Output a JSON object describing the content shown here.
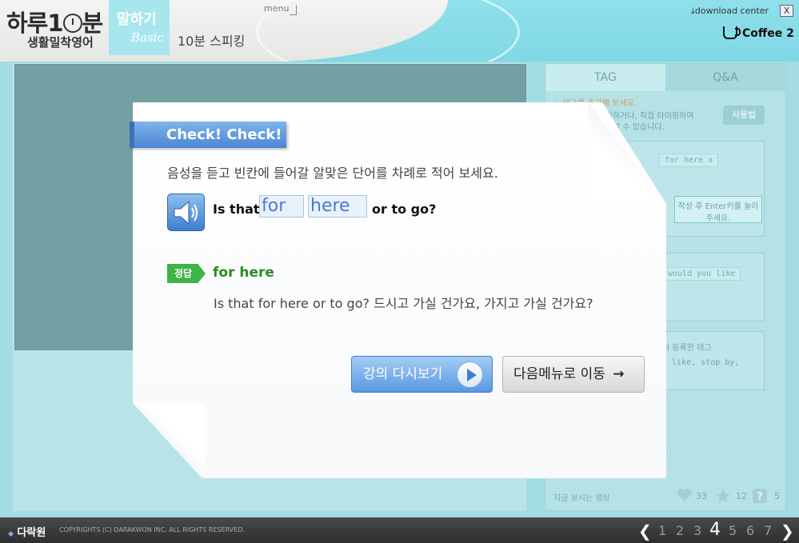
{
  "header": {
    "logo_main_a": "하루1",
    "logo_main_b": "분",
    "logo_sub": "생활밀착영어",
    "tab_title": "말하기",
    "tab_subtitle": "Basic",
    "subtitle": "10분 스피킹",
    "menu": "menu",
    "download": "download center",
    "close": "X",
    "coffee": "Coffee 2"
  },
  "right_panel": {
    "tabs": [
      "TAG",
      "Q&A"
    ],
    "hint1": "+ 태그를 추가해 보세요.",
    "hint2": "그를 클릭하거나, 직접 타이핑하여",
    "hint3": "까지 추가할 수 있습니다.",
    "use_button": "사용법",
    "tag_example": "for here",
    "tag_x": "x",
    "bubble": "작성 후 Enter키를 눌러 주세요.",
    "tag2": "would you like",
    "registered": "이 등록한 태그",
    "registered_tags": "o like, stop by,",
    "footer_label": "지금 보시는 영상",
    "likes": "33",
    "stars": "12",
    "questions": "5"
  },
  "dialog": {
    "badge": "Check! Check!",
    "instruction": "음성을 듣고 빈칸에 들어갈 알맞은 단어를 차례로 적어 보세요.",
    "sentence_start": "Is that",
    "blank1": "for",
    "blank2": "here",
    "sentence_end": "or to go?",
    "answer_badge": "정답",
    "answer": "for here",
    "answer_full": "Is that for here or to go? 드시고 가실 건가요, 가지고 가실 건가요?",
    "replay_button": "강의 다시보기",
    "next_button": "다음메뉴로 이동"
  },
  "footer": {
    "logo": "다락원",
    "copyright": "COPYRIGHTS (C) DARAKWON INC. ALL RIGHTS RESERVED.",
    "pages": [
      "1",
      "2",
      "3",
      "4",
      "5",
      "6",
      "7"
    ],
    "current_page": "4"
  }
}
